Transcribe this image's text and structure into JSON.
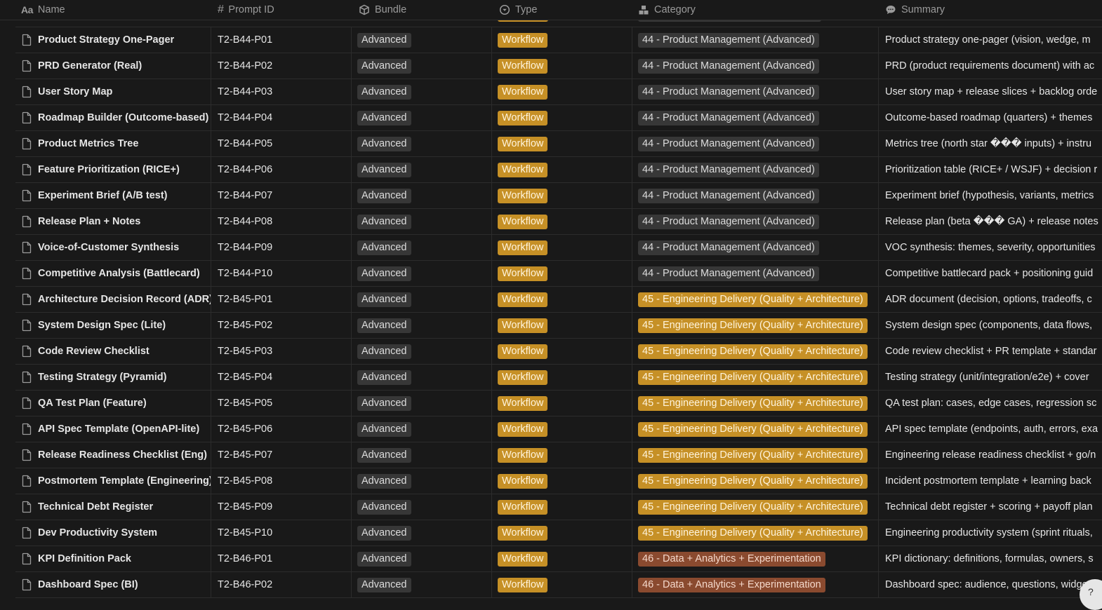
{
  "header": {
    "columns": [
      {
        "label": "Name",
        "icon": "Aa"
      },
      {
        "label": "Prompt ID",
        "icon": "#"
      },
      {
        "label": "Bundle",
        "icon": "bundle-icon"
      },
      {
        "label": "Type",
        "icon": "select-icon"
      },
      {
        "label": "Category",
        "icon": "category-icon"
      },
      {
        "label": "Summary",
        "icon": "summary-icon"
      }
    ]
  },
  "colors": {
    "background": "#191919",
    "type_tag": "#c69026",
    "bundle_tag": "#373737",
    "category_44": "#373737",
    "category_45": "#c69026",
    "category_46": "#8a4a2f"
  },
  "rows": [
    {
      "name": "Product Strategy One-Pager",
      "id": "T2-B44-P01",
      "bundle": "Advanced",
      "type": "Workflow",
      "category": "44 - Product Management (Advanced)",
      "cat": 44,
      "summary": "Product strategy one-pager (vision, wedge, m"
    },
    {
      "name": "PRD Generator (Real)",
      "id": "T2-B44-P02",
      "bundle": "Advanced",
      "type": "Workflow",
      "category": "44 - Product Management (Advanced)",
      "cat": 44,
      "summary": "PRD (product requirements document) with ac"
    },
    {
      "name": "User Story Map",
      "id": "T2-B44-P03",
      "bundle": "Advanced",
      "type": "Workflow",
      "category": "44 - Product Management (Advanced)",
      "cat": 44,
      "summary": "User story map + release slices + backlog orde"
    },
    {
      "name": "Roadmap Builder (Outcome-based)",
      "id": "T2-B44-P04",
      "bundle": "Advanced",
      "type": "Workflow",
      "category": "44 - Product Management (Advanced)",
      "cat": 44,
      "summary": "Outcome-based roadmap (quarters) + themes"
    },
    {
      "name": "Product Metrics Tree",
      "id": "T2-B44-P05",
      "bundle": "Advanced",
      "type": "Workflow",
      "category": "44 - Product Management (Advanced)",
      "cat": 44,
      "summary": "Metrics tree (north star ��� inputs) + instru"
    },
    {
      "name": "Feature Prioritization (RICE+)",
      "id": "T2-B44-P06",
      "bundle": "Advanced",
      "type": "Workflow",
      "category": "44 - Product Management (Advanced)",
      "cat": 44,
      "summary": "Prioritization table (RICE+ / WSJF) + decision r"
    },
    {
      "name": "Experiment Brief (A/B test)",
      "id": "T2-B44-P07",
      "bundle": "Advanced",
      "type": "Workflow",
      "category": "44 - Product Management (Advanced)",
      "cat": 44,
      "summary": "Experiment brief (hypothesis, variants, metrics"
    },
    {
      "name": "Release Plan + Notes",
      "id": "T2-B44-P08",
      "bundle": "Advanced",
      "type": "Workflow",
      "category": "44 - Product Management (Advanced)",
      "cat": 44,
      "summary": "Release plan (beta ��� GA) + release notes"
    },
    {
      "name": "Voice-of-Customer Synthesis",
      "id": "T2-B44-P09",
      "bundle": "Advanced",
      "type": "Workflow",
      "category": "44 - Product Management (Advanced)",
      "cat": 44,
      "summary": "VOC synthesis: themes, severity, opportunities"
    },
    {
      "name": "Competitive Analysis (Battlecard)",
      "id": "T2-B44-P10",
      "bundle": "Advanced",
      "type": "Workflow",
      "category": "44 - Product Management (Advanced)",
      "cat": 44,
      "summary": "Competitive battlecard pack + positioning guid"
    },
    {
      "name": "Architecture Decision Record (ADR)",
      "id": "T2-B45-P01",
      "bundle": "Advanced",
      "type": "Workflow",
      "category": "45 - Engineering Delivery (Quality + Architecture)",
      "cat": 45,
      "summary": "ADR document (decision, options, tradeoffs, c"
    },
    {
      "name": "System Design Spec (Lite)",
      "id": "T2-B45-P02",
      "bundle": "Advanced",
      "type": "Workflow",
      "category": "45 - Engineering Delivery (Quality + Architecture)",
      "cat": 45,
      "summary": "System design spec (components, data flows,"
    },
    {
      "name": "Code Review Checklist",
      "id": "T2-B45-P03",
      "bundle": "Advanced",
      "type": "Workflow",
      "category": "45 - Engineering Delivery (Quality + Architecture)",
      "cat": 45,
      "summary": "Code review checklist + PR template + standar"
    },
    {
      "name": "Testing Strategy (Pyramid)",
      "id": "T2-B45-P04",
      "bundle": "Advanced",
      "type": "Workflow",
      "category": "45 - Engineering Delivery (Quality + Architecture)",
      "cat": 45,
      "summary": "Testing strategy (unit/integration/e2e) + cover"
    },
    {
      "name": "QA Test Plan (Feature)",
      "id": "T2-B45-P05",
      "bundle": "Advanced",
      "type": "Workflow",
      "category": "45 - Engineering Delivery (Quality + Architecture)",
      "cat": 45,
      "summary": "QA test plan: cases, edge cases, regression sc"
    },
    {
      "name": "API Spec Template (OpenAPI-lite)",
      "id": "T2-B45-P06",
      "bundle": "Advanced",
      "type": "Workflow",
      "category": "45 - Engineering Delivery (Quality + Architecture)",
      "cat": 45,
      "summary": "API spec template (endpoints, auth, errors, exa"
    },
    {
      "name": "Release Readiness Checklist (Eng)",
      "id": "T2-B45-P07",
      "bundle": "Advanced",
      "type": "Workflow",
      "category": "45 - Engineering Delivery (Quality + Architecture)",
      "cat": 45,
      "summary": "Engineering release readiness checklist + go/n"
    },
    {
      "name": "Postmortem Template (Engineering)",
      "id": "T2-B45-P08",
      "bundle": "Advanced",
      "type": "Workflow",
      "category": "45 - Engineering Delivery (Quality + Architecture)",
      "cat": 45,
      "summary": "Incident postmortem template + learning back"
    },
    {
      "name": "Technical Debt Register",
      "id": "T2-B45-P09",
      "bundle": "Advanced",
      "type": "Workflow",
      "category": "45 - Engineering Delivery (Quality + Architecture)",
      "cat": 45,
      "summary": "Technical debt register + scoring + payoff plan"
    },
    {
      "name": "Dev Productivity System",
      "id": "T2-B45-P10",
      "bundle": "Advanced",
      "type": "Workflow",
      "category": "45 - Engineering Delivery (Quality + Architecture)",
      "cat": 45,
      "summary": "Engineering productivity system (sprint rituals,"
    },
    {
      "name": "KPI Definition Pack",
      "id": "T2-B46-P01",
      "bundle": "Advanced",
      "type": "Workflow",
      "category": "46 - Data + Analytics + Experimentation",
      "cat": 46,
      "summary": "KPI dictionary: definitions, formulas, owners, s"
    },
    {
      "name": "Dashboard Spec (BI)",
      "id": "T2-B46-P02",
      "bundle": "Advanced",
      "type": "Workflow",
      "category": "46 - Data + Analytics + Experimentation",
      "cat": 46,
      "summary": "Dashboard spec: audience, questions, widge"
    }
  ]
}
